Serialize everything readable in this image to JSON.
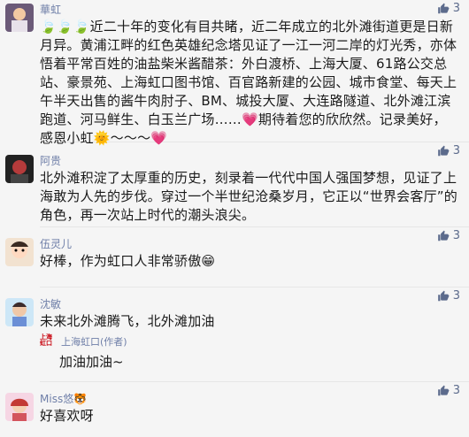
{
  "comments": [
    {
      "name": "華虹",
      "likes": "3",
      "text": "🍃🍃🍃近二十年的变化有目共睹，近二年成立的北外滩街道更是日新月异。黄浦江畔的红色英雄纪念塔见证了一江一河二岸的灯光秀，亦体悟着平常百姓的油盐柴米酱醋茶：外白渡桥、上海大厦、61路公交总站、豪景苑、上海虹口图书馆、百官路新建的公园、城市食堂、每天上午半天出售的酱牛肉肘子、BM、城投大厦、大连路隧道、北外滩江滨跑道、河马鲜生、白玉兰广场……💗期待着您的欣欣然。记录美好，感恩小虹🌞～～～💗"
    },
    {
      "name": "阿贵",
      "likes": "3",
      "text": "北外滩积淀了太厚重的历史，刻录着一代代中国人强国梦想，见证了上海敢为人先的步伐。穿过一个半世纪沧桑岁月，它正以“世界会客厅”的角色，再一次站上时代的潮头浪尖。"
    },
    {
      "name": "伍灵儿",
      "likes": "3",
      "text": "好棒，作为虹口人非常骄傲😁"
    },
    {
      "name": "沈敏",
      "likes": "3",
      "text": "未来北外滩腾飞，北外滩加油",
      "reply": {
        "logo": "上海\n虹口",
        "name": "上海虹口(作者)",
        "text": "加油加油~"
      }
    },
    {
      "name": "Miss悠🐯",
      "likes": "3",
      "text": "好喜欢呀"
    }
  ]
}
